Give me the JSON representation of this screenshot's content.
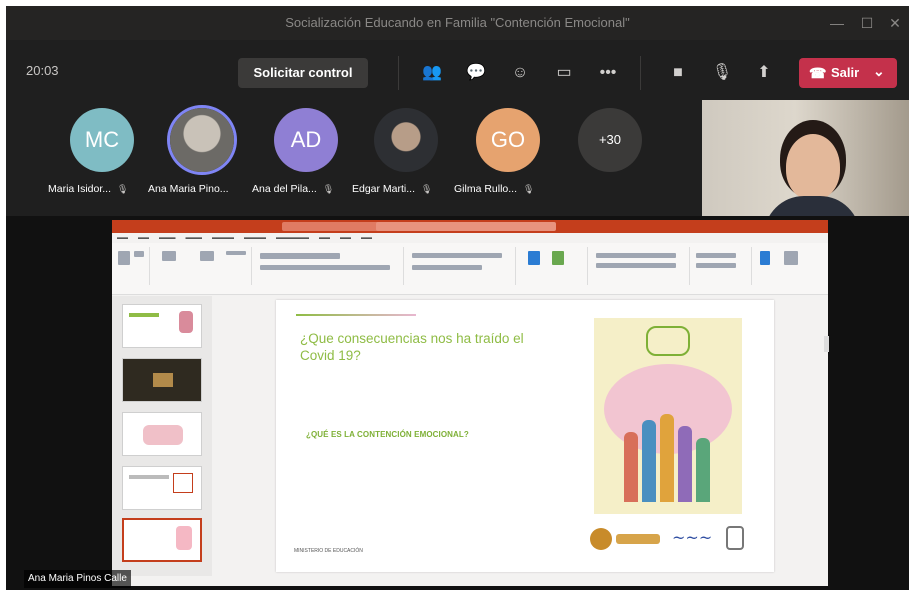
{
  "window": {
    "title": "Socialización Educando en Familia \"Contención Emocional\""
  },
  "toolbar": {
    "timer": "20:03",
    "control_label": "Solicitar control",
    "leave_label": "Salir",
    "icons": [
      "people-icon",
      "chat-icon",
      "reactions-icon",
      "rooms-icon",
      "more-icon",
      "camera-icon",
      "mic-off-icon",
      "share-icon",
      "phone-icon",
      "chevron-down-icon"
    ]
  },
  "participants": [
    {
      "initials": "MC",
      "name": "Maria Isidor...",
      "color": "#7fbcc4",
      "photo": false
    },
    {
      "initials": "",
      "name": "Ana Maria Pino...",
      "color": "",
      "photo": true,
      "active": true
    },
    {
      "initials": "AD",
      "name": "Ana del Pila...",
      "color": "#8f7fd4",
      "photo": false
    },
    {
      "initials": "",
      "name": "Edgar Marti...",
      "color": "",
      "photo": true
    },
    {
      "initials": "GO",
      "name": "Gilma Rullo...",
      "color": "#e6a36f",
      "photo": false
    }
  ],
  "more_participants": "+30",
  "slide": {
    "question": "¿Que consecuencias nos ha traído el Covid 19?",
    "subtitle": "¿QUÉ ES LA CONTENCIÓN EMOCIONAL?",
    "footer": "MINISTERIO DE EDUCACIÓN"
  },
  "presenter_name": "Ana Maria Pinos Calle"
}
